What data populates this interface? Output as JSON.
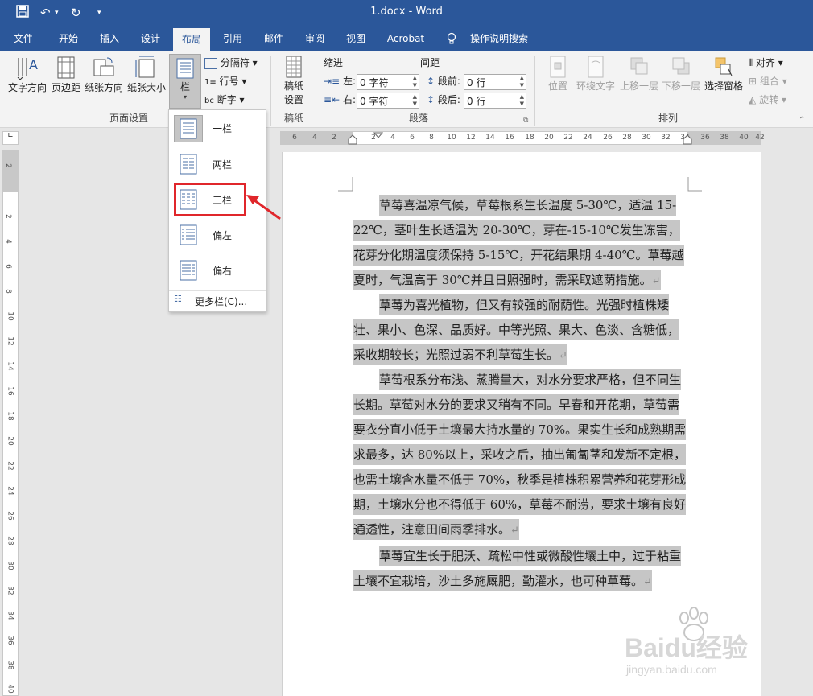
{
  "titlebar": {
    "doc_title": "1.docx  -  Word",
    "qa_save": "💾",
    "qa_undo": "↶",
    "qa_undo_arrow": "▾",
    "qa_redo": "↻",
    "qa_custom": "▾"
  },
  "tabs": [
    "文件",
    "开始",
    "插入",
    "设计",
    "布局",
    "引用",
    "邮件",
    "审阅",
    "视图",
    "Acrobat",
    "操作说明搜索"
  ],
  "active_tab": "布局",
  "ribbon": {
    "page_setup": {
      "text_direction": "文字方向",
      "margins": "页边距",
      "orientation": "纸张方向",
      "size": "纸张大小",
      "columns": "栏",
      "breaks": "分隔符",
      "line_numbers": "行号",
      "hyphenation": "断字",
      "group_label": "页面设置"
    },
    "manuscript": {
      "button_line1": "稿纸",
      "button_line2": "设置",
      "group_label": "稿纸"
    },
    "paragraph": {
      "indent_label": "缩进",
      "spacing_label": "间距",
      "left_label": "左:",
      "left_value": "0 字符",
      "right_label": "右:",
      "right_value": "0 字符",
      "before_label": "段前:",
      "before_value": "0 行",
      "after_label": "段后:",
      "after_value": "0 行",
      "group_label": "段落"
    },
    "arrange": {
      "position": "位置",
      "wrap_text": "环绕文字",
      "bring_forward": "上移一层",
      "send_backward": "下移一层",
      "selection_pane": "选择窗格",
      "align": "对齐",
      "group": "组合",
      "rotate": "旋转",
      "group_label": "排列"
    }
  },
  "columns_menu": {
    "items": [
      "一栏",
      "两栏",
      "三栏",
      "偏左",
      "偏右"
    ],
    "more": "更多栏(C)..."
  },
  "ruler": {
    "h_left": [
      "6",
      "4",
      "2"
    ],
    "h_main": [
      "2",
      "4",
      "6",
      "8",
      "10",
      "12",
      "14",
      "16",
      "18",
      "20",
      "22",
      "24",
      "26",
      "28",
      "30",
      "32",
      "34"
    ],
    "h_right": [
      "36",
      "38",
      "40",
      "42"
    ],
    "v_numbers": [
      "2",
      "2",
      "4",
      "6",
      "8",
      "10",
      "12",
      "14",
      "16",
      "18",
      "20",
      "22",
      "24",
      "26",
      "28",
      "30",
      "32",
      "34",
      "36",
      "38",
      "40"
    ]
  },
  "document": {
    "paragraphs": [
      "草莓喜温凉气候，草莓根系生长温度 5-30℃，适温 15-22℃，茎叶生长适温为 20-30℃，芽在-15-10℃发生冻害，花芽分化期温度须保持 5-15℃，开花结果期 4-40℃。草莓越夏时，气温高于 30℃并且日照强时，需采取遮荫措施。",
      "草莓为喜光植物，但又有较强的耐荫性。光强时植株矮壮、果小、色深、品质好。中等光照、果大、色淡、含糖低，采收期较长；光照过弱不利草莓生长。",
      "草莓根系分布浅、蒸腾量大，对水分要求严格，但不同生长期。草莓对水分的要求又稍有不同。早春和开花期，草莓需要衣分直小低于土壤最大持水量的 70%。果实生长和成熟期需求最多，达 80%以上，采收之后，抽出匍匐茎和发新不定根，也需土壤含水量不低于 70%，秋季是植株积累营养和花芽形成期，土壤水分也不得低于 60%，草莓不耐涝，要求土壤有良好通透性，注意田间雨季排水。",
      "草莓宜生长于肥沃、疏松中性或微酸性壤土中，过于粘重土壤不宜栽培，沙土多施厩肥，勤灌水，也可种草莓。"
    ],
    "para_mark": "↵"
  },
  "watermark": {
    "brand": "Baidu经验",
    "url": "jingyan.baidu.com"
  },
  "colors": {
    "brand": "#2b579a",
    "highlight": "#e0262b",
    "selection": "#c6c6c6"
  }
}
